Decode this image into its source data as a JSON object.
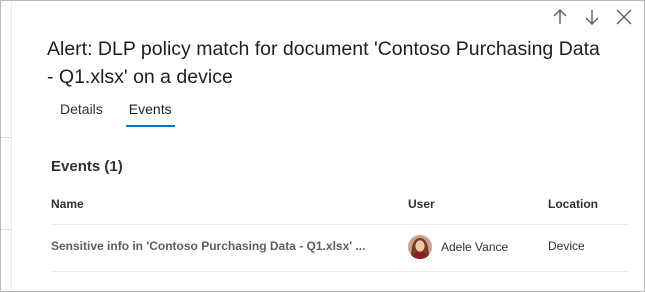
{
  "panel": {
    "title": "Alert: DLP policy match for document 'Contoso Purchasing Data - Q1.xlsx' on a device",
    "nav": {
      "previous_icon": "arrow-up-icon",
      "next_icon": "arrow-down-icon",
      "close_icon": "close-icon"
    }
  },
  "tabs": [
    {
      "label": "Details",
      "active": false
    },
    {
      "label": "Events",
      "active": true
    }
  ],
  "events": {
    "heading": "Events (1)",
    "columns": [
      "Name",
      "User",
      "Location"
    ],
    "rows": [
      {
        "name": "Sensitive info in 'Contoso Purchasing Data - Q1.xlsx' ...",
        "user": "Adele Vance",
        "location": "Device"
      }
    ]
  },
  "colors": {
    "accent": "#0078d4",
    "text": "#323130",
    "divider": "#edebe9"
  }
}
